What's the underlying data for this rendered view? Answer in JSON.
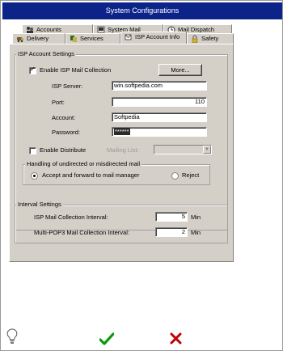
{
  "window": {
    "title": "System Configurations"
  },
  "tabs": {
    "row1": [
      {
        "label": "Accounts",
        "icon": "accounts-icon"
      },
      {
        "label": "System Mail",
        "icon": "system-mail-icon"
      },
      {
        "label": "Mail Dispatch",
        "icon": "mail-dispatch-icon"
      }
    ],
    "row2": [
      {
        "label": "Delivery",
        "icon": "delivery-icon"
      },
      {
        "label": "Services",
        "icon": "services-icon"
      },
      {
        "label": "ISP Account Info",
        "icon": "isp-account-icon",
        "active": true
      },
      {
        "label": "Safety",
        "icon": "lock-icon"
      }
    ]
  },
  "isp": {
    "group_title": "ISP Account Settings",
    "enable_label": "Enable ISP Mail Collection",
    "enable_checked": true,
    "more_label": "More...",
    "server_label": "ISP Server:",
    "server_value": "win.softpedia.com",
    "port_label": "Port:",
    "port_value": "110",
    "account_label": "Account:",
    "account_value": "Softpedia",
    "password_label": "Password:",
    "password_value": "******",
    "distribute_label": "Enable Distribute",
    "distribute_checked": false,
    "mailing_list_label": "Mailing List:",
    "handling_title": "Handling of undirected or misdirected mail",
    "accept_label": "Accept and forward to mail manager",
    "reject_label": "Reject",
    "accept_selected": true
  },
  "interval": {
    "group_title": "Interval Settings",
    "isp_label": "ISP Mail Collection Interval:",
    "isp_value": "5",
    "isp_unit": "Min",
    "pop3_label": "Multi-POP3 Mail Collection Interval:",
    "pop3_value": "2",
    "pop3_unit": "Min"
  },
  "footer": {
    "help_icon": "lightbulb-icon",
    "ok_icon": "checkmark-icon",
    "cancel_icon": "cross-icon",
    "colors": {
      "ok": "#0a9a0a",
      "cancel": "#c00000",
      "title": "#0c248a"
    }
  }
}
